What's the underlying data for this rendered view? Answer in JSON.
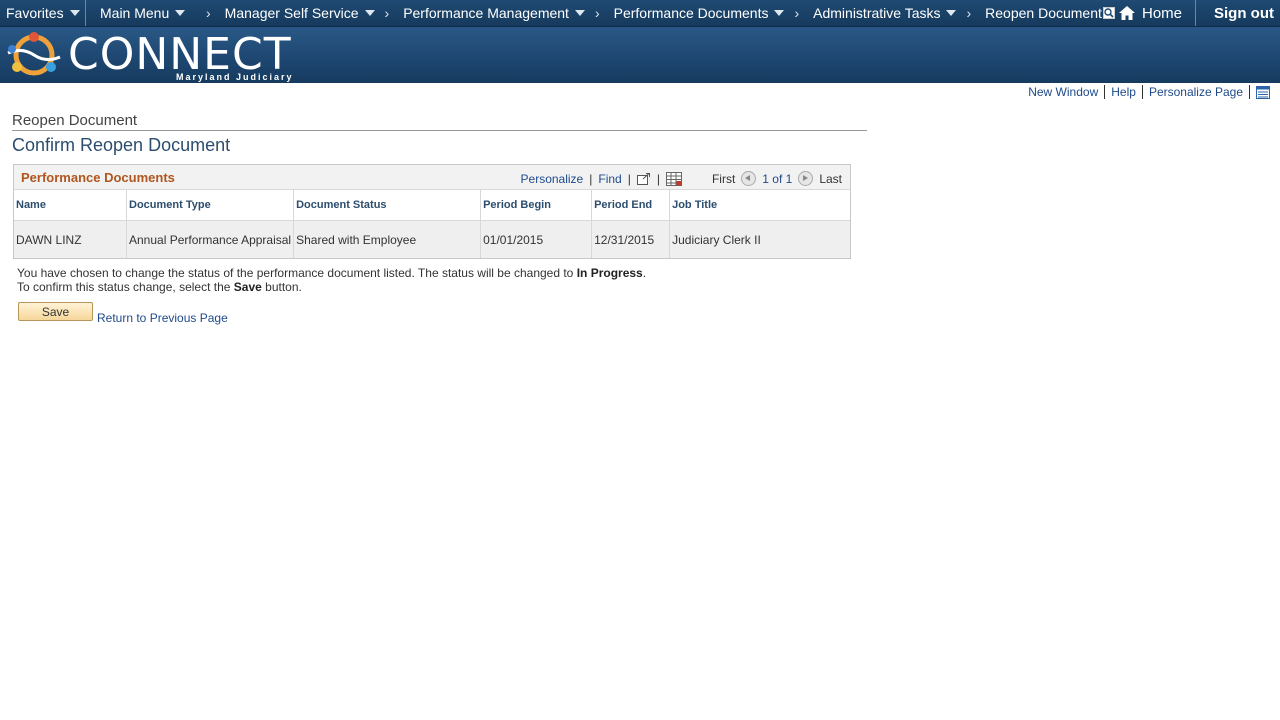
{
  "nav": {
    "favorites": "Favorites",
    "main_menu": "Main Menu",
    "crumbs": [
      "Manager Self Service",
      "Performance Management",
      "Performance Documents",
      "Administrative Tasks"
    ],
    "current": "Reopen Document",
    "home": "Home",
    "sign_out": "Sign out"
  },
  "banner": {
    "logo_text": "CONNECT",
    "logo_sub": "Maryland Judiciary"
  },
  "util": {
    "new_window": "New Window",
    "help": "Help",
    "personalize_page": "Personalize Page"
  },
  "page": {
    "crumb_title": "Reopen Document",
    "title": "Confirm Reopen Document"
  },
  "grid": {
    "title": "Performance Documents",
    "personalize": "Personalize",
    "find": "Find",
    "first": "First",
    "count": "1 of 1",
    "last": "Last",
    "columns": [
      "Name",
      "Document Type",
      "Document Status",
      "Period Begin",
      "Period End",
      "Job Title"
    ],
    "rows": [
      [
        "DAWN LINZ",
        "Annual Performance Appraisal",
        "Shared with Employee",
        "01/01/2015",
        "12/31/2015",
        "Judiciary Clerk II"
      ]
    ]
  },
  "message": {
    "line1_a": "You have chosen to change the status of the performance document listed. The status will be changed to ",
    "line1_b": "In Progress",
    "line1_c": ".",
    "line2_a": "To confirm this status change, select the ",
    "line2_b": "Save",
    "line2_c": " button."
  },
  "actions": {
    "save": "Save",
    "return": "Return to Previous Page"
  }
}
